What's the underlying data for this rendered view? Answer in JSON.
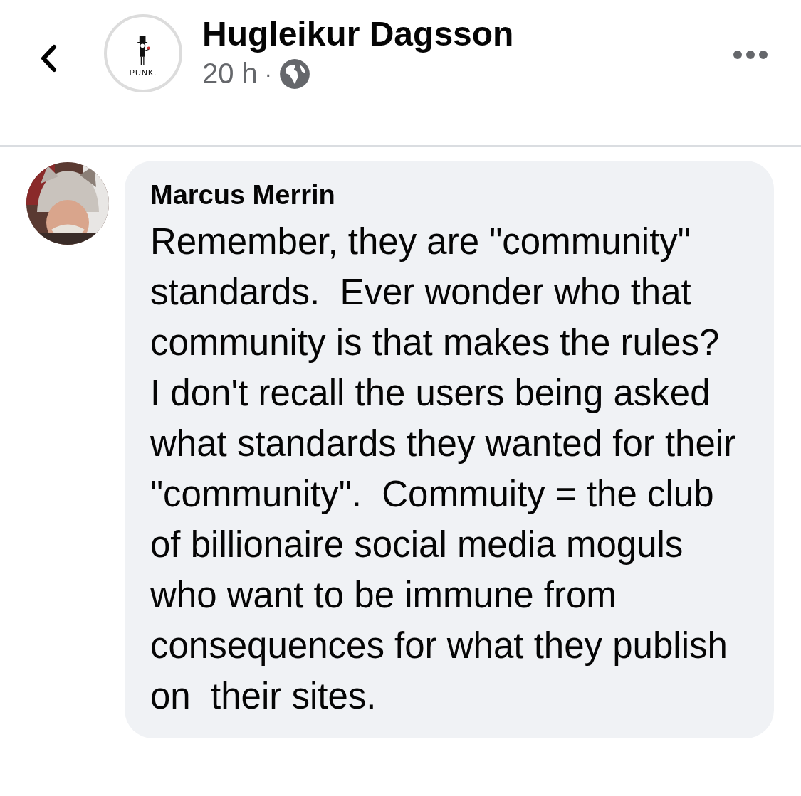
{
  "header": {
    "page_name": "Hugleikur Dagsson",
    "avatar_caption": "PUNK.",
    "time": "20 h",
    "separator": "·"
  },
  "comment": {
    "author": "Marcus Merrin",
    "text": "Remember, they are \"community\" standards.  Ever wonder who that community is that makes the rules?  I don't recall the users being asked what standards they wanted for their \"community\".  Commuity = the club of billionaire social media moguls who want to be immune from consequences for what they publish on  their sites."
  }
}
